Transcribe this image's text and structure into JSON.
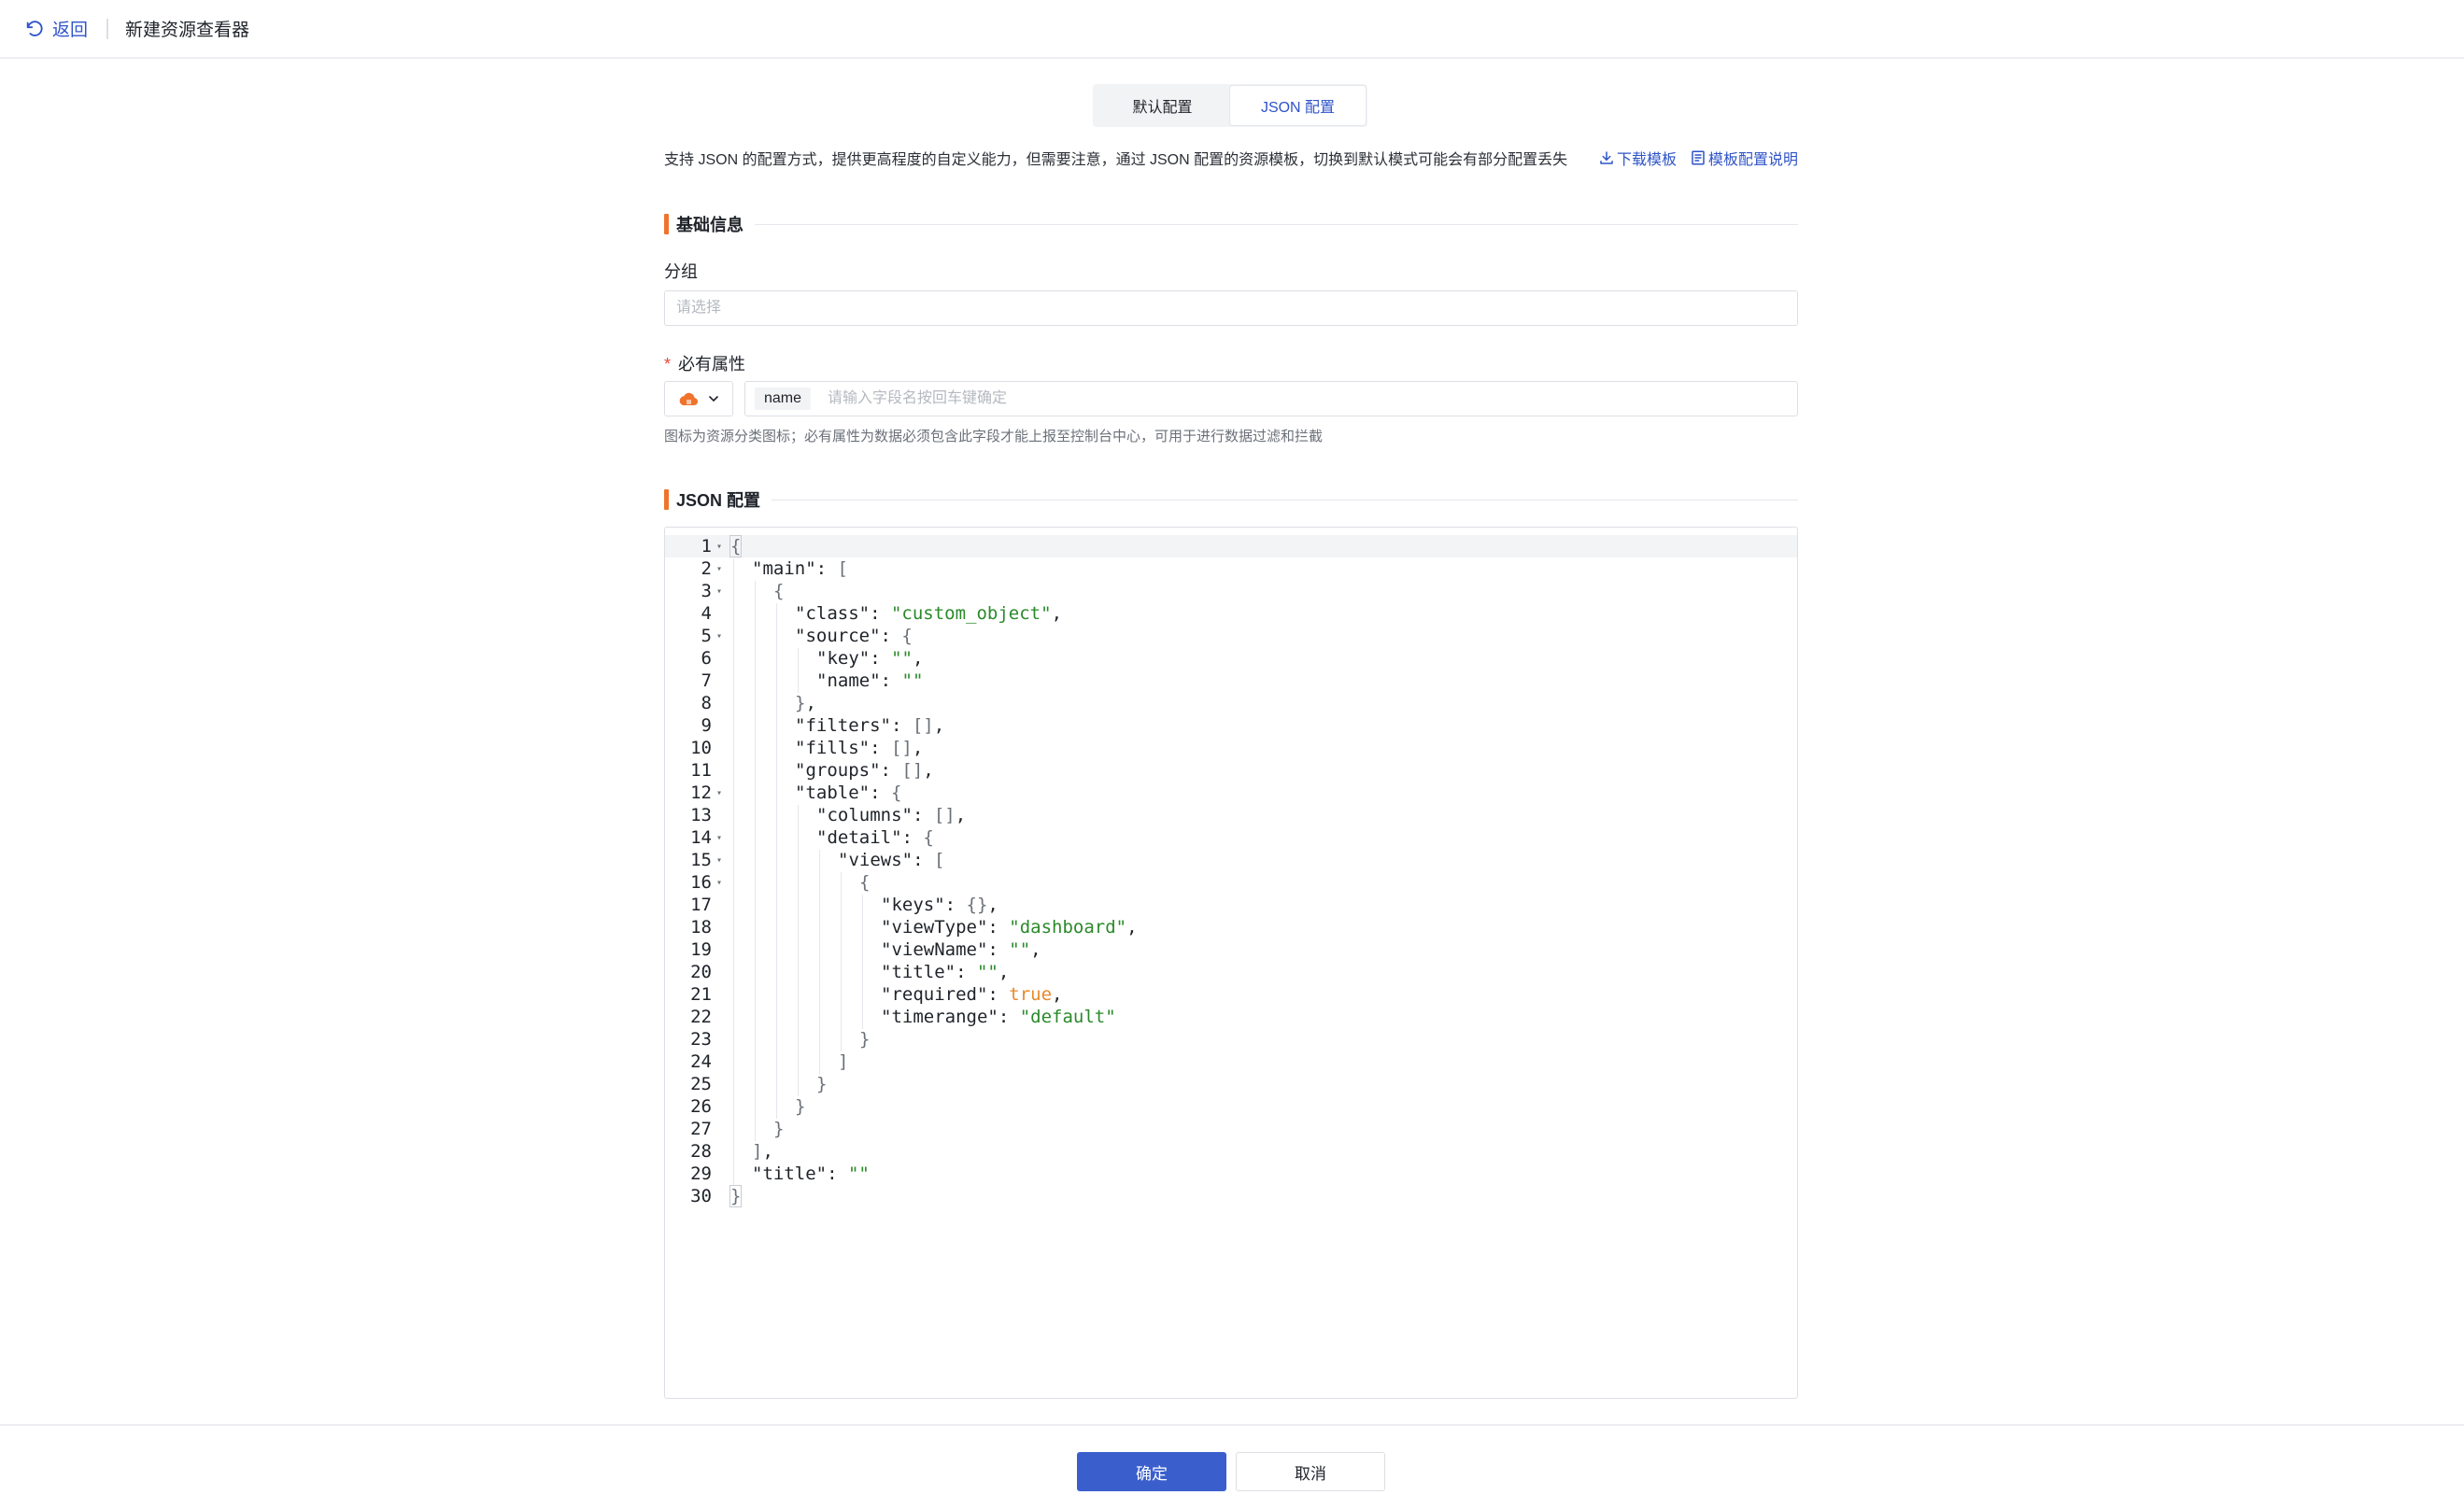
{
  "header": {
    "back_label": "返回",
    "title": "新建资源查看器"
  },
  "tabs": [
    {
      "label": "默认配置",
      "active": false
    },
    {
      "label": "JSON 配置",
      "active": true
    }
  ],
  "description": {
    "text": "支持 JSON 的配置方式，提供更高程度的自定义能力，但需要注意，通过 JSON 配置的资源模板，切换到默认模式可能会有部分配置丢失",
    "download_label": "下载模板",
    "doc_label": "模板配置说明"
  },
  "basic_section": {
    "title": "基础信息"
  },
  "group_field": {
    "label": "分组",
    "placeholder": "请选择",
    "value": ""
  },
  "required_attr": {
    "star": "*",
    "label": "必有属性",
    "tag": "name",
    "placeholder": "请输入字段名按回车键确定",
    "hint": "图标为资源分类图标；必有属性为数据必须包含此字段才能上报至控制台中心，可用于进行数据过滤和拦截"
  },
  "json_section": {
    "title": "JSON 配置"
  },
  "editor": {
    "lines": [
      {
        "n": "1",
        "fold": true,
        "indent": 0,
        "tokens": [
          [
            "br",
            "{"
          ]
        ]
      },
      {
        "n": "2",
        "fold": true,
        "indent": 1,
        "tokens": [
          [
            "key",
            "\"main\""
          ],
          [
            "punc",
            ": "
          ],
          [
            "br",
            "["
          ]
        ]
      },
      {
        "n": "3",
        "fold": true,
        "indent": 2,
        "tokens": [
          [
            "br",
            "{"
          ]
        ]
      },
      {
        "n": "4",
        "fold": false,
        "indent": 3,
        "tokens": [
          [
            "key",
            "\"class\""
          ],
          [
            "punc",
            ": "
          ],
          [
            "str",
            "\"custom_object\""
          ],
          [
            "punc",
            ","
          ]
        ]
      },
      {
        "n": "5",
        "fold": true,
        "indent": 3,
        "tokens": [
          [
            "key",
            "\"source\""
          ],
          [
            "punc",
            ": "
          ],
          [
            "br",
            "{"
          ]
        ]
      },
      {
        "n": "6",
        "fold": false,
        "indent": 4,
        "tokens": [
          [
            "key",
            "\"key\""
          ],
          [
            "punc",
            ": "
          ],
          [
            "str",
            "\"\""
          ],
          [
            "punc",
            ","
          ]
        ]
      },
      {
        "n": "7",
        "fold": false,
        "indent": 4,
        "tokens": [
          [
            "key",
            "\"name\""
          ],
          [
            "punc",
            ": "
          ],
          [
            "str",
            "\"\""
          ]
        ]
      },
      {
        "n": "8",
        "fold": false,
        "indent": 3,
        "tokens": [
          [
            "br",
            "}"
          ],
          [
            "punc",
            ","
          ]
        ]
      },
      {
        "n": "9",
        "fold": false,
        "indent": 3,
        "tokens": [
          [
            "key",
            "\"filters\""
          ],
          [
            "punc",
            ": "
          ],
          [
            "br",
            "[]"
          ],
          [
            "punc",
            ","
          ]
        ]
      },
      {
        "n": "10",
        "fold": false,
        "indent": 3,
        "tokens": [
          [
            "key",
            "\"fills\""
          ],
          [
            "punc",
            ": "
          ],
          [
            "br",
            "[]"
          ],
          [
            "punc",
            ","
          ]
        ]
      },
      {
        "n": "11",
        "fold": false,
        "indent": 3,
        "tokens": [
          [
            "key",
            "\"groups\""
          ],
          [
            "punc",
            ": "
          ],
          [
            "br",
            "[]"
          ],
          [
            "punc",
            ","
          ]
        ]
      },
      {
        "n": "12",
        "fold": true,
        "indent": 3,
        "tokens": [
          [
            "key",
            "\"table\""
          ],
          [
            "punc",
            ": "
          ],
          [
            "br",
            "{"
          ]
        ]
      },
      {
        "n": "13",
        "fold": false,
        "indent": 4,
        "tokens": [
          [
            "key",
            "\"columns\""
          ],
          [
            "punc",
            ": "
          ],
          [
            "br",
            "[]"
          ],
          [
            "punc",
            ","
          ]
        ]
      },
      {
        "n": "14",
        "fold": true,
        "indent": 4,
        "tokens": [
          [
            "key",
            "\"detail\""
          ],
          [
            "punc",
            ": "
          ],
          [
            "br",
            "{"
          ]
        ]
      },
      {
        "n": "15",
        "fold": true,
        "indent": 5,
        "tokens": [
          [
            "key",
            "\"views\""
          ],
          [
            "punc",
            ": "
          ],
          [
            "br",
            "["
          ]
        ]
      },
      {
        "n": "16",
        "fold": true,
        "indent": 6,
        "tokens": [
          [
            "br",
            "{"
          ]
        ]
      },
      {
        "n": "17",
        "fold": false,
        "indent": 7,
        "tokens": [
          [
            "key",
            "\"keys\""
          ],
          [
            "punc",
            ": "
          ],
          [
            "br",
            "{}"
          ],
          [
            "punc",
            ","
          ]
        ]
      },
      {
        "n": "18",
        "fold": false,
        "indent": 7,
        "tokens": [
          [
            "key",
            "\"viewType\""
          ],
          [
            "punc",
            ": "
          ],
          [
            "str",
            "\"dashboard\""
          ],
          [
            "punc",
            ","
          ]
        ]
      },
      {
        "n": "19",
        "fold": false,
        "indent": 7,
        "tokens": [
          [
            "key",
            "\"viewName\""
          ],
          [
            "punc",
            ": "
          ],
          [
            "str",
            "\"\""
          ],
          [
            "punc",
            ","
          ]
        ]
      },
      {
        "n": "20",
        "fold": false,
        "indent": 7,
        "tokens": [
          [
            "key",
            "\"title\""
          ],
          [
            "punc",
            ": "
          ],
          [
            "str",
            "\"\""
          ],
          [
            "punc",
            ","
          ]
        ]
      },
      {
        "n": "21",
        "fold": false,
        "indent": 7,
        "tokens": [
          [
            "key",
            "\"required\""
          ],
          [
            "punc",
            ": "
          ],
          [
            "bool",
            "true"
          ],
          [
            "punc",
            ","
          ]
        ]
      },
      {
        "n": "22",
        "fold": false,
        "indent": 7,
        "tokens": [
          [
            "key",
            "\"timerange\""
          ],
          [
            "punc",
            ": "
          ],
          [
            "str",
            "\"default\""
          ]
        ]
      },
      {
        "n": "23",
        "fold": false,
        "indent": 6,
        "tokens": [
          [
            "br",
            "}"
          ]
        ]
      },
      {
        "n": "24",
        "fold": false,
        "indent": 5,
        "tokens": [
          [
            "br",
            "]"
          ]
        ]
      },
      {
        "n": "25",
        "fold": false,
        "indent": 4,
        "tokens": [
          [
            "br",
            "}"
          ]
        ]
      },
      {
        "n": "26",
        "fold": false,
        "indent": 3,
        "tokens": [
          [
            "br",
            "}"
          ]
        ]
      },
      {
        "n": "27",
        "fold": false,
        "indent": 2,
        "tokens": [
          [
            "br",
            "}"
          ]
        ]
      },
      {
        "n": "28",
        "fold": false,
        "indent": 1,
        "tokens": [
          [
            "br",
            "]"
          ],
          [
            "punc",
            ","
          ]
        ]
      },
      {
        "n": "29",
        "fold": false,
        "indent": 1,
        "tokens": [
          [
            "key",
            "\"title\""
          ],
          [
            "punc",
            ": "
          ],
          [
            "str",
            "\"\""
          ]
        ]
      },
      {
        "n": "30",
        "fold": false,
        "indent": 0,
        "tokens": [
          [
            "br",
            "}"
          ]
        ]
      }
    ]
  },
  "footer": {
    "confirm_label": "确定",
    "cancel_label": "取消"
  }
}
